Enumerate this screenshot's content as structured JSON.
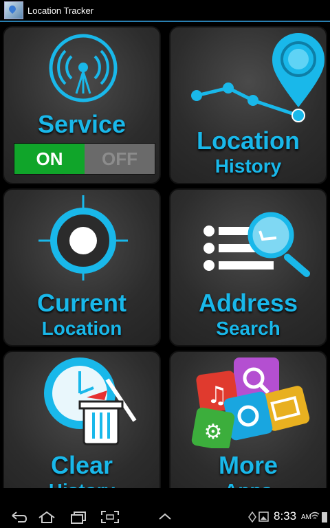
{
  "titlebar": {
    "title": "Location Tracker"
  },
  "tiles": {
    "service": {
      "label": "Service",
      "toggle_on": "ON",
      "toggle_off": "OFF",
      "state": "on"
    },
    "history": {
      "line1": "Location",
      "line2": "History"
    },
    "current": {
      "line1": "Current",
      "line2": "Location"
    },
    "address": {
      "line1": "Address",
      "line2": "Search"
    },
    "clear": {
      "line1": "Clear",
      "line2": "History"
    },
    "more": {
      "line1": "More",
      "line2": "Apps"
    }
  },
  "statusbar": {
    "time": "8:33",
    "ampm": "AM"
  },
  "colors": {
    "accent": "#19b8ea",
    "on": "#10a52a",
    "off": "#6a6a6a",
    "tile": "#2c2c2c"
  }
}
